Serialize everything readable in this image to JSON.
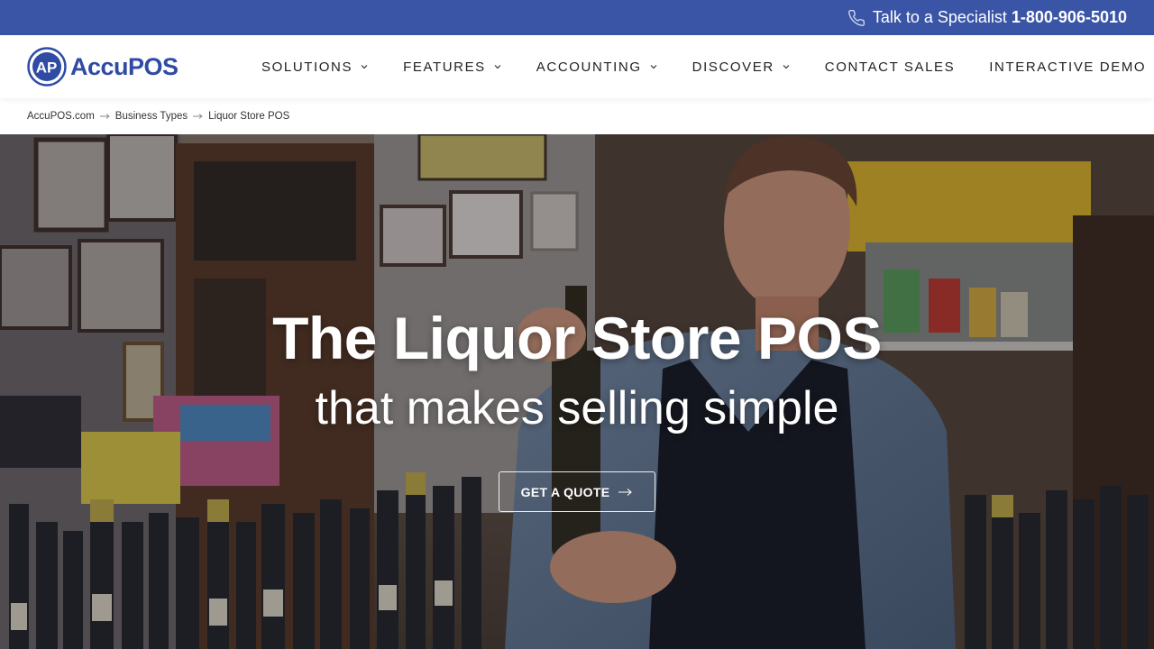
{
  "topbar": {
    "phone_label": "Talk to a Specialist",
    "phone_number": "1-800-906-5010",
    "icon": "phone-icon",
    "bg_color": "#3a55a6"
  },
  "logo": {
    "mark_text": "AP",
    "brand": "AccuPOS",
    "color": "#2f4ba3"
  },
  "nav": {
    "items": [
      {
        "label": "SOLUTIONS"
      },
      {
        "label": "FEATURES"
      },
      {
        "label": "ACCOUNTING"
      },
      {
        "label": "DISCOVER"
      },
      {
        "label": "CONTACT SALES"
      },
      {
        "label": "INTERACTIVE DEMO"
      }
    ]
  },
  "breadcrumb": {
    "items": [
      "AccuPOS.com",
      "Business Types",
      "Liquor Store POS"
    ]
  },
  "hero": {
    "title": "The Liquor Store POS",
    "subtitle": "that makes selling simple",
    "cta_label": "GET A QUOTE"
  }
}
